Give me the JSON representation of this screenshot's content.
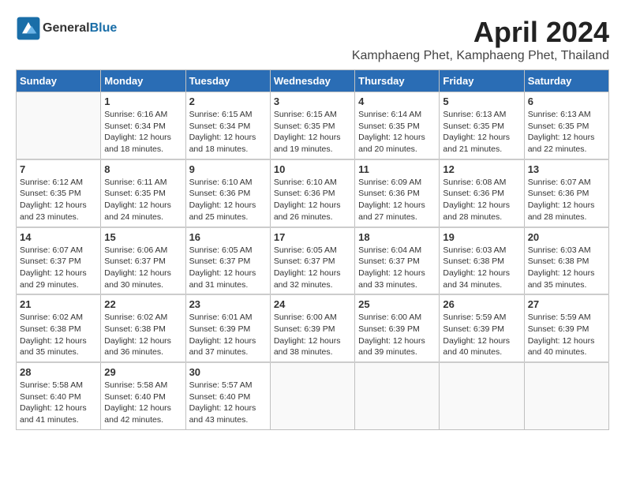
{
  "logo": {
    "general": "General",
    "blue": "Blue"
  },
  "title": {
    "month_year": "April 2024",
    "location": "Kamphaeng Phet, Kamphaeng Phet, Thailand"
  },
  "headers": [
    "Sunday",
    "Monday",
    "Tuesday",
    "Wednesday",
    "Thursday",
    "Friday",
    "Saturday"
  ],
  "weeks": [
    [
      {
        "day": "",
        "sunrise": "",
        "sunset": "",
        "daylight": ""
      },
      {
        "day": "1",
        "sunrise": "Sunrise: 6:16 AM",
        "sunset": "Sunset: 6:34 PM",
        "daylight": "Daylight: 12 hours and 18 minutes."
      },
      {
        "day": "2",
        "sunrise": "Sunrise: 6:15 AM",
        "sunset": "Sunset: 6:34 PM",
        "daylight": "Daylight: 12 hours and 18 minutes."
      },
      {
        "day": "3",
        "sunrise": "Sunrise: 6:15 AM",
        "sunset": "Sunset: 6:35 PM",
        "daylight": "Daylight: 12 hours and 19 minutes."
      },
      {
        "day": "4",
        "sunrise": "Sunrise: 6:14 AM",
        "sunset": "Sunset: 6:35 PM",
        "daylight": "Daylight: 12 hours and 20 minutes."
      },
      {
        "day": "5",
        "sunrise": "Sunrise: 6:13 AM",
        "sunset": "Sunset: 6:35 PM",
        "daylight": "Daylight: 12 hours and 21 minutes."
      },
      {
        "day": "6",
        "sunrise": "Sunrise: 6:13 AM",
        "sunset": "Sunset: 6:35 PM",
        "daylight": "Daylight: 12 hours and 22 minutes."
      }
    ],
    [
      {
        "day": "7",
        "sunrise": "Sunrise: 6:12 AM",
        "sunset": "Sunset: 6:35 PM",
        "daylight": "Daylight: 12 hours and 23 minutes."
      },
      {
        "day": "8",
        "sunrise": "Sunrise: 6:11 AM",
        "sunset": "Sunset: 6:35 PM",
        "daylight": "Daylight: 12 hours and 24 minutes."
      },
      {
        "day": "9",
        "sunrise": "Sunrise: 6:10 AM",
        "sunset": "Sunset: 6:36 PM",
        "daylight": "Daylight: 12 hours and 25 minutes."
      },
      {
        "day": "10",
        "sunrise": "Sunrise: 6:10 AM",
        "sunset": "Sunset: 6:36 PM",
        "daylight": "Daylight: 12 hours and 26 minutes."
      },
      {
        "day": "11",
        "sunrise": "Sunrise: 6:09 AM",
        "sunset": "Sunset: 6:36 PM",
        "daylight": "Daylight: 12 hours and 27 minutes."
      },
      {
        "day": "12",
        "sunrise": "Sunrise: 6:08 AM",
        "sunset": "Sunset: 6:36 PM",
        "daylight": "Daylight: 12 hours and 28 minutes."
      },
      {
        "day": "13",
        "sunrise": "Sunrise: 6:07 AM",
        "sunset": "Sunset: 6:36 PM",
        "daylight": "Daylight: 12 hours and 28 minutes."
      }
    ],
    [
      {
        "day": "14",
        "sunrise": "Sunrise: 6:07 AM",
        "sunset": "Sunset: 6:37 PM",
        "daylight": "Daylight: 12 hours and 29 minutes."
      },
      {
        "day": "15",
        "sunrise": "Sunrise: 6:06 AM",
        "sunset": "Sunset: 6:37 PM",
        "daylight": "Daylight: 12 hours and 30 minutes."
      },
      {
        "day": "16",
        "sunrise": "Sunrise: 6:05 AM",
        "sunset": "Sunset: 6:37 PM",
        "daylight": "Daylight: 12 hours and 31 minutes."
      },
      {
        "day": "17",
        "sunrise": "Sunrise: 6:05 AM",
        "sunset": "Sunset: 6:37 PM",
        "daylight": "Daylight: 12 hours and 32 minutes."
      },
      {
        "day": "18",
        "sunrise": "Sunrise: 6:04 AM",
        "sunset": "Sunset: 6:37 PM",
        "daylight": "Daylight: 12 hours and 33 minutes."
      },
      {
        "day": "19",
        "sunrise": "Sunrise: 6:03 AM",
        "sunset": "Sunset: 6:38 PM",
        "daylight": "Daylight: 12 hours and 34 minutes."
      },
      {
        "day": "20",
        "sunrise": "Sunrise: 6:03 AM",
        "sunset": "Sunset: 6:38 PM",
        "daylight": "Daylight: 12 hours and 35 minutes."
      }
    ],
    [
      {
        "day": "21",
        "sunrise": "Sunrise: 6:02 AM",
        "sunset": "Sunset: 6:38 PM",
        "daylight": "Daylight: 12 hours and 35 minutes."
      },
      {
        "day": "22",
        "sunrise": "Sunrise: 6:02 AM",
        "sunset": "Sunset: 6:38 PM",
        "daylight": "Daylight: 12 hours and 36 minutes."
      },
      {
        "day": "23",
        "sunrise": "Sunrise: 6:01 AM",
        "sunset": "Sunset: 6:39 PM",
        "daylight": "Daylight: 12 hours and 37 minutes."
      },
      {
        "day": "24",
        "sunrise": "Sunrise: 6:00 AM",
        "sunset": "Sunset: 6:39 PM",
        "daylight": "Daylight: 12 hours and 38 minutes."
      },
      {
        "day": "25",
        "sunrise": "Sunrise: 6:00 AM",
        "sunset": "Sunset: 6:39 PM",
        "daylight": "Daylight: 12 hours and 39 minutes."
      },
      {
        "day": "26",
        "sunrise": "Sunrise: 5:59 AM",
        "sunset": "Sunset: 6:39 PM",
        "daylight": "Daylight: 12 hours and 40 minutes."
      },
      {
        "day": "27",
        "sunrise": "Sunrise: 5:59 AM",
        "sunset": "Sunset: 6:39 PM",
        "daylight": "Daylight: 12 hours and 40 minutes."
      }
    ],
    [
      {
        "day": "28",
        "sunrise": "Sunrise: 5:58 AM",
        "sunset": "Sunset: 6:40 PM",
        "daylight": "Daylight: 12 hours and 41 minutes."
      },
      {
        "day": "29",
        "sunrise": "Sunrise: 5:58 AM",
        "sunset": "Sunset: 6:40 PM",
        "daylight": "Daylight: 12 hours and 42 minutes."
      },
      {
        "day": "30",
        "sunrise": "Sunrise: 5:57 AM",
        "sunset": "Sunset: 6:40 PM",
        "daylight": "Daylight: 12 hours and 43 minutes."
      },
      {
        "day": "",
        "sunrise": "",
        "sunset": "",
        "daylight": ""
      },
      {
        "day": "",
        "sunrise": "",
        "sunset": "",
        "daylight": ""
      },
      {
        "day": "",
        "sunrise": "",
        "sunset": "",
        "daylight": ""
      },
      {
        "day": "",
        "sunrise": "",
        "sunset": "",
        "daylight": ""
      }
    ]
  ]
}
